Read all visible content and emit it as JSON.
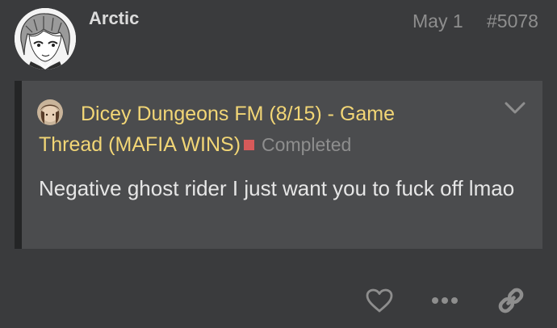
{
  "post": {
    "username": "Arctic",
    "date": "May 1",
    "number": "#5078"
  },
  "quote": {
    "title": "Dicey Dungeons FM (8/15) - Game Thread (MAFIA WINS)",
    "status": "Completed",
    "status_color": "#d75a5a",
    "title_color": "#f2d676",
    "body": "Negative ghost rider I just want you to fuck off lmao"
  },
  "actions": {
    "like_icon": "heart-icon",
    "more_icon": "ellipsis-icon",
    "share_icon": "link-icon"
  }
}
